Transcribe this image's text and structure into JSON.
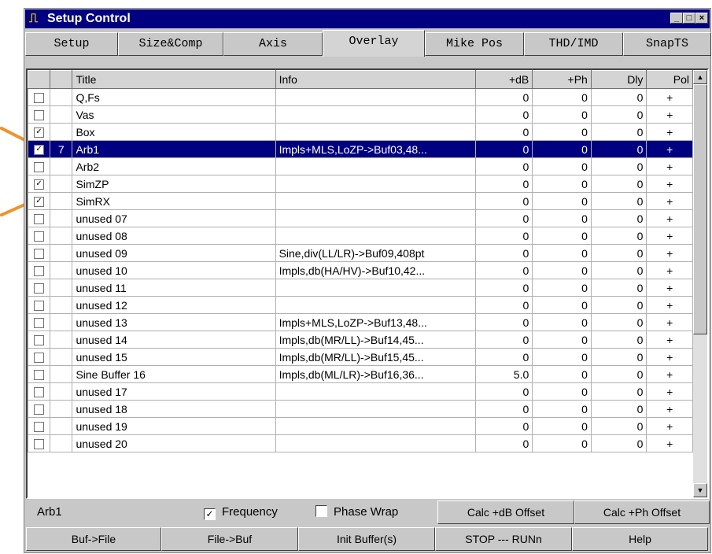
{
  "window": {
    "title": "Setup Control",
    "icon": "waveform-icon",
    "controls": [
      "minimize-icon",
      "maximize-icon",
      "close-icon"
    ]
  },
  "tabs": [
    "Setup",
    "Size&Comp",
    "Axis",
    "Overlay",
    "Mike Pos",
    "THD/IMD",
    "SnapTS"
  ],
  "active_tab": "Overlay",
  "columns": [
    "",
    "",
    "Title",
    "Info",
    "+dB",
    "+Ph",
    "Dly",
    "Pol"
  ],
  "rows": [
    {
      "checked": false,
      "idx": "",
      "title": "Q,Fs",
      "info": "",
      "db": "0",
      "ph": "0",
      "dly": "0",
      "pol": "+"
    },
    {
      "checked": false,
      "idx": "",
      "title": "Vas",
      "info": "",
      "db": "0",
      "ph": "0",
      "dly": "0",
      "pol": "+"
    },
    {
      "checked": true,
      "idx": "",
      "title": "Box",
      "info": "",
      "db": "0",
      "ph": "0",
      "dly": "0",
      "pol": "+"
    },
    {
      "checked": true,
      "idx": "7",
      "title": "Arb1",
      "info": "Impls+MLS,LoZP->Buf03,48...",
      "db": "0",
      "ph": "0",
      "dly": "0",
      "pol": "+",
      "selected": true
    },
    {
      "checked": false,
      "idx": "",
      "title": "Arb2",
      "info": "",
      "db": "0",
      "ph": "0",
      "dly": "0",
      "pol": "+"
    },
    {
      "checked": true,
      "idx": "",
      "title": "SimZP",
      "info": "",
      "db": "0",
      "ph": "0",
      "dly": "0",
      "pol": "+"
    },
    {
      "checked": true,
      "idx": "",
      "title": "SimRX",
      "info": "",
      "db": "0",
      "ph": "0",
      "dly": "0",
      "pol": "+"
    },
    {
      "checked": false,
      "idx": "",
      "title": "unused 07",
      "info": "",
      "db": "0",
      "ph": "0",
      "dly": "0",
      "pol": "+"
    },
    {
      "checked": false,
      "idx": "",
      "title": "unused 08",
      "info": "",
      "db": "0",
      "ph": "0",
      "dly": "0",
      "pol": "+"
    },
    {
      "checked": false,
      "idx": "",
      "title": "unused 09",
      "info": "Sine,div(LL/LR)->Buf09,408pt",
      "db": "0",
      "ph": "0",
      "dly": "0",
      "pol": "+"
    },
    {
      "checked": false,
      "idx": "",
      "title": "unused 10",
      "info": "Impls,db(HA/HV)->Buf10,42...",
      "db": "0",
      "ph": "0",
      "dly": "0",
      "pol": "+"
    },
    {
      "checked": false,
      "idx": "",
      "title": "unused 11",
      "info": "",
      "db": "0",
      "ph": "0",
      "dly": "0",
      "pol": "+"
    },
    {
      "checked": false,
      "idx": "",
      "title": "unused 12",
      "info": "",
      "db": "0",
      "ph": "0",
      "dly": "0",
      "pol": "+"
    },
    {
      "checked": false,
      "idx": "",
      "title": "unused 13",
      "info": "Impls+MLS,LoZP->Buf13,48...",
      "db": "0",
      "ph": "0",
      "dly": "0",
      "pol": "+"
    },
    {
      "checked": false,
      "idx": "",
      "title": "unused 14",
      "info": "Impls,db(MR/LL)->Buf14,45...",
      "db": "0",
      "ph": "0",
      "dly": "0",
      "pol": "+"
    },
    {
      "checked": false,
      "idx": "",
      "title": "unused 15",
      "info": "Impls,db(MR/LL)->Buf15,45...",
      "db": "0",
      "ph": "0",
      "dly": "0",
      "pol": "+"
    },
    {
      "checked": false,
      "idx": "",
      "title": "Sine Buffer 16",
      "info": "Impls,db(ML/LR)->Buf16,36...",
      "db": "5.0",
      "ph": "0",
      "dly": "0",
      "pol": "+"
    },
    {
      "checked": false,
      "idx": "",
      "title": "unused 17",
      "info": "",
      "db": "0",
      "ph": "0",
      "dly": "0",
      "pol": "+"
    },
    {
      "checked": false,
      "idx": "",
      "title": "unused 18",
      "info": "",
      "db": "0",
      "ph": "0",
      "dly": "0",
      "pol": "+"
    },
    {
      "checked": false,
      "idx": "",
      "title": "unused 19",
      "info": "",
      "db": "0",
      "ph": "0",
      "dly": "0",
      "pol": "+"
    },
    {
      "checked": false,
      "idx": "",
      "title": "unused 20",
      "info": "",
      "db": "0",
      "ph": "0",
      "dly": "0",
      "pol": "+"
    }
  ],
  "status": {
    "current": "Arb1",
    "frequency_label": "Frequency",
    "frequency_checked": true,
    "phase_wrap_label": "Phase Wrap",
    "phase_wrap_checked": false,
    "calc_db": "Calc +dB Offset",
    "calc_ph": "Calc +Ph Offset"
  },
  "buttons": [
    "Buf->File",
    "File->Buf",
    "Init Buffer(s)",
    "STOP --- RUNn",
    "Help"
  ],
  "colors": {
    "title_bar": "#000080",
    "selection": "#000080",
    "annotation_arrow": "#f0922b"
  }
}
